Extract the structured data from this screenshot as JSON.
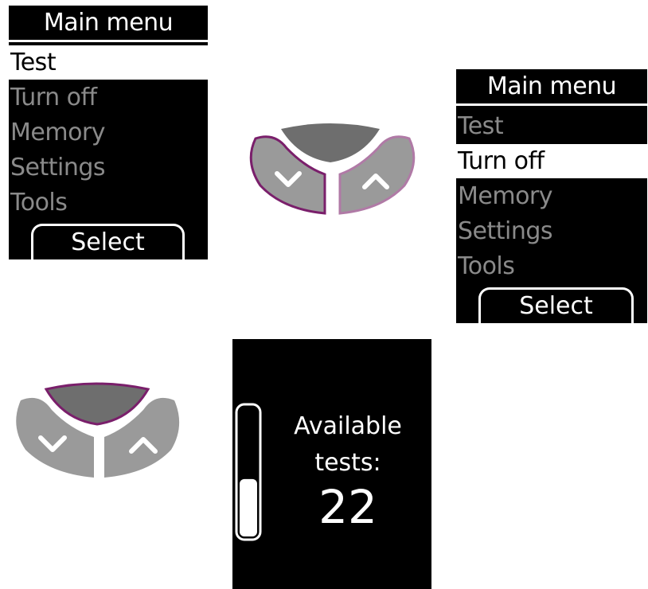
{
  "screen1": {
    "title": "Main menu",
    "items": [
      "Test",
      "Turn off",
      "Memory",
      "Settings",
      "Tools"
    ],
    "selected_index": 0,
    "softkey_label": "Select"
  },
  "screen2": {
    "title": "Main menu",
    "items": [
      "Test",
      "Turn off",
      "Memory",
      "Settings",
      "Tools"
    ],
    "selected_index": 1,
    "softkey_label": "Select"
  },
  "keypad1": {
    "highlighted": "down-button"
  },
  "keypad2": {
    "highlighted": "center-button"
  },
  "status_screen": {
    "line1": "Available",
    "line2": "tests:",
    "count": "22",
    "level_fraction": 0.44
  },
  "colors": {
    "highlight": "#7a1f6b",
    "highlight_light": "#b07aa6",
    "button_gray": "#9a9a9a",
    "center_gray": "#6e6e6e",
    "inactive_text": "#8a8a8a"
  }
}
